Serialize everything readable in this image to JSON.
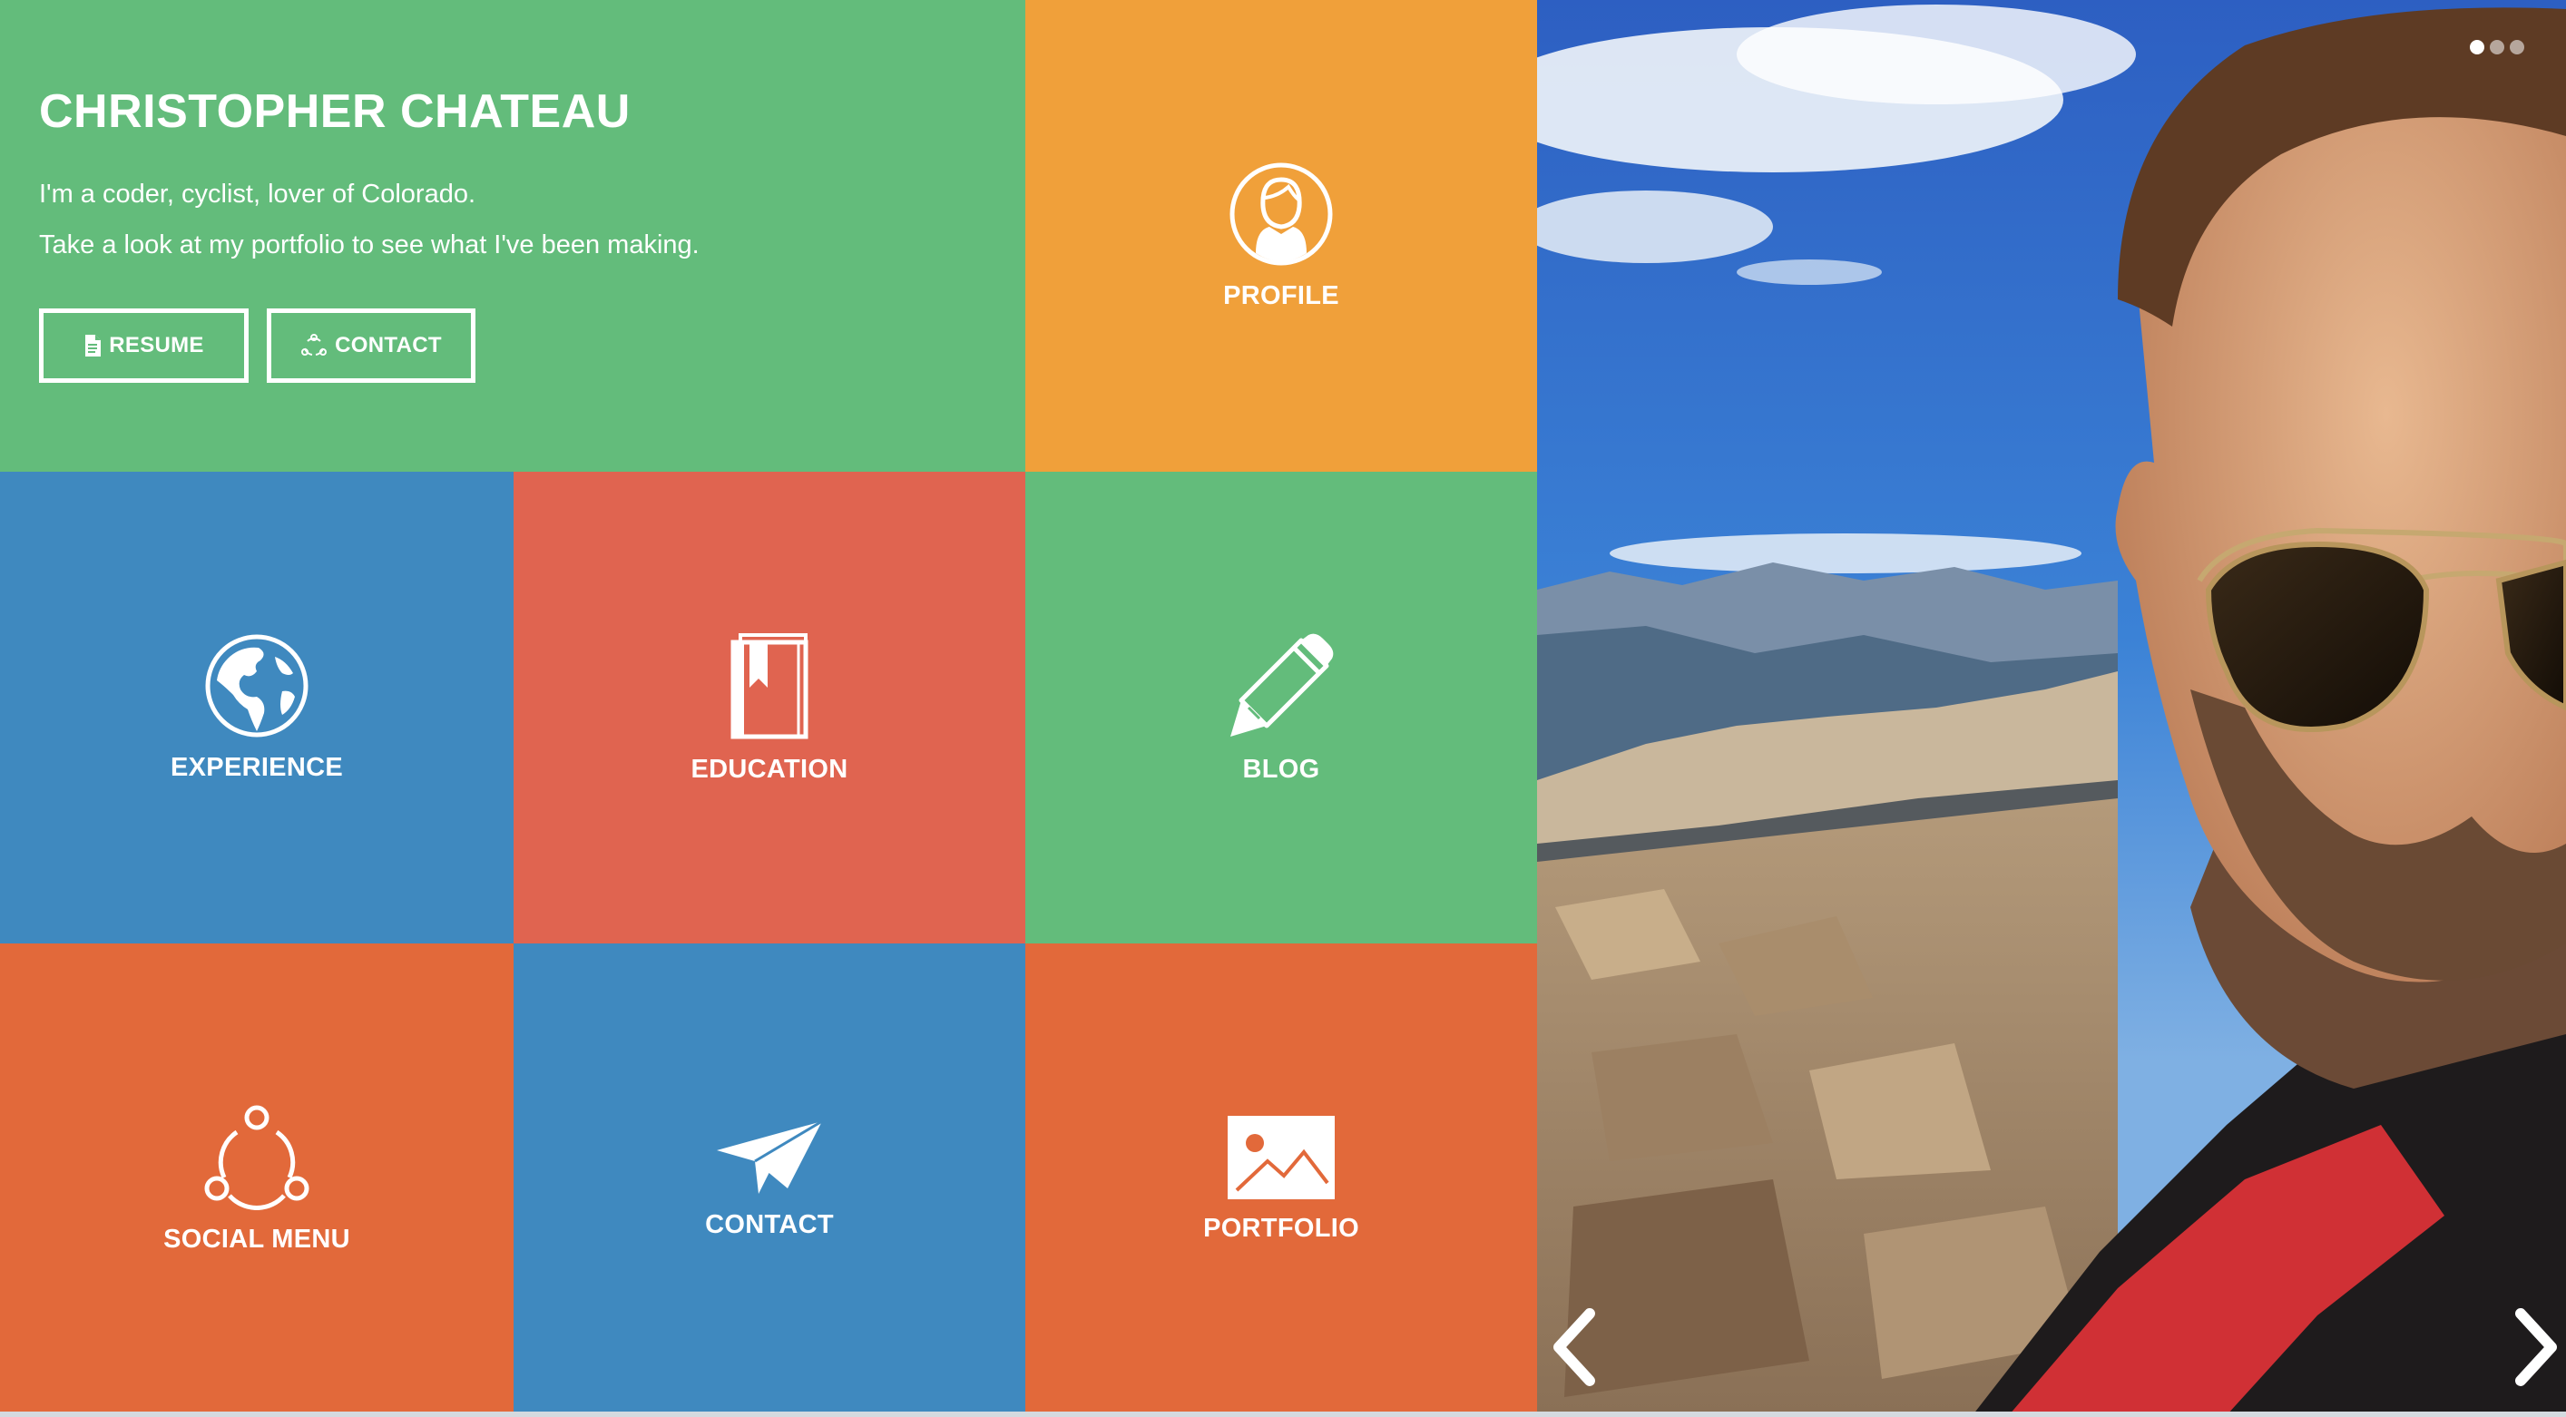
{
  "hero": {
    "name": "CHRISTOPHER CHATEAU",
    "tagline_1": "I'm a coder, cyclist, lover of Colorado.",
    "tagline_2": "Take a look at my portfolio to see what I've been making.",
    "resume_label": "RESUME",
    "contact_label": "CONTACT",
    "background_color": "#63bc7b"
  },
  "tiles": {
    "profile": {
      "label": "PROFILE",
      "icon": "user-icon",
      "color": "#f0a03a"
    },
    "experience": {
      "label": "EXPERIENCE",
      "icon": "globe-icon",
      "color": "#3f89bf"
    },
    "education": {
      "label": "EDUCATION",
      "icon": "book-icon",
      "color": "#e06450"
    },
    "blog": {
      "label": "BLOG",
      "icon": "pencil-icon",
      "color": "#63bc7b"
    },
    "social": {
      "label": "SOCIAL MENU",
      "icon": "share-network-icon",
      "color": "#e2693a"
    },
    "contact": {
      "label": "CONTACT",
      "icon": "paper-plane-icon",
      "color": "#3f89bf"
    },
    "portfolio": {
      "label": "PORTFOLIO",
      "icon": "image-icon",
      "color": "#e2693a"
    }
  },
  "slider": {
    "slide_count": 3,
    "active_slide": 1,
    "prev_icon": "chevron-left-icon",
    "next_icon": "chevron-right-icon"
  }
}
